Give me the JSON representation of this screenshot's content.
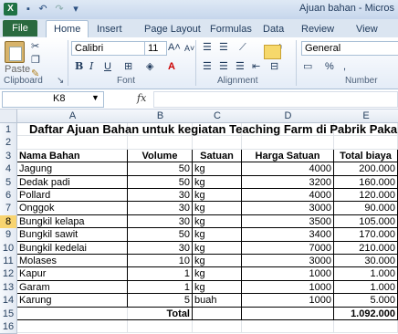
{
  "window": {
    "title": "Ajuan bahan - Micros"
  },
  "quick_access": {
    "save_icon": "save-icon",
    "undo_icon": "undo-icon",
    "redo_icon": "redo-icon"
  },
  "tabs": [
    {
      "label": "File"
    },
    {
      "label": "Home"
    },
    {
      "label": "Insert"
    },
    {
      "label": "Page Layout"
    },
    {
      "label": "Formulas"
    },
    {
      "label": "Data"
    },
    {
      "label": "Review"
    },
    {
      "label": "View"
    }
  ],
  "ribbon": {
    "clipboard": {
      "label": "Clipboard",
      "paste": "Paste"
    },
    "font": {
      "label": "Font",
      "name": "Calibri",
      "size": "11",
      "bold": "B",
      "italic": "I",
      "underline": "U"
    },
    "alignment": {
      "label": "Alignment"
    },
    "number": {
      "label": "Number",
      "format": "General",
      "percent": "%"
    }
  },
  "formula_bar": {
    "name_box": "K8",
    "fx": "fx",
    "value": ""
  },
  "columns": [
    "A",
    "B",
    "C",
    "D",
    "E"
  ],
  "rows": [
    "1",
    "2",
    "3",
    "4",
    "5",
    "6",
    "7",
    "8",
    "9",
    "10",
    "11",
    "12",
    "13",
    "14",
    "15",
    "16"
  ],
  "selected_row": "8",
  "sheet": {
    "title": "Daftar Ajuan Bahan untuk kegiatan Teaching Farm di Pabrik Pakan",
    "headers": [
      "Nama Bahan",
      "Volume",
      "Satuan",
      "Harga Satuan",
      "Total biaya"
    ],
    "items": [
      [
        "Jagung",
        "50",
        "kg",
        "4000",
        "200.000"
      ],
      [
        "Dedak padi",
        "50",
        "kg",
        "3200",
        "160.000"
      ],
      [
        "Pollard",
        "30",
        "kg",
        "4000",
        "120.000"
      ],
      [
        "Onggok",
        "30",
        "kg",
        "3000",
        "90.000"
      ],
      [
        "Bungkil kelapa",
        "30",
        "kg",
        "3500",
        "105.000"
      ],
      [
        "Bungkil sawit",
        "50",
        "kg",
        "3400",
        "170.000"
      ],
      [
        "Bungkil kedelai",
        "30",
        "kg",
        "7000",
        "210.000"
      ],
      [
        "Molases",
        "10",
        "kg",
        "3000",
        "30.000"
      ],
      [
        "Kapur",
        "1",
        "kg",
        "1000",
        "1.000"
      ],
      [
        "Garam",
        "1",
        "kg",
        "1000",
        "1.000"
      ],
      [
        "Karung",
        "5",
        "buah",
        "1000",
        "5.000"
      ]
    ],
    "total_label": "Total",
    "total_value": "1.092.000"
  }
}
